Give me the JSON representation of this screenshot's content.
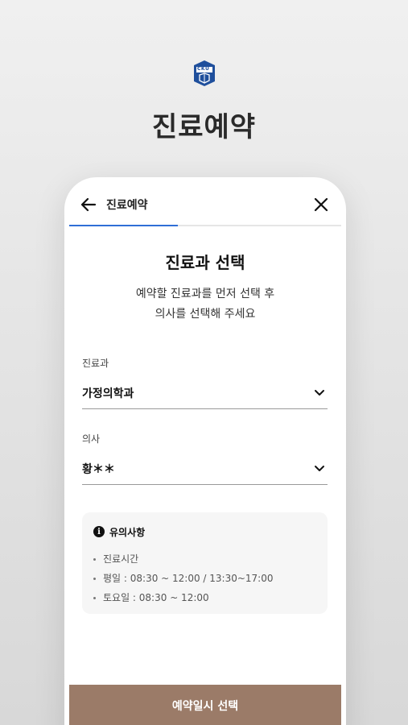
{
  "hero": {
    "logo_text": "CKU",
    "title": "진료예약"
  },
  "topbar": {
    "title": "진료예약",
    "progress_percent": 40
  },
  "step": {
    "title": "진료과 선택",
    "desc_line1": "예약할 진료과를 먼저 선택 후",
    "desc_line2": "의사를 선택해 주세요"
  },
  "fields": {
    "department": {
      "label": "진료과",
      "value": "가정의학과"
    },
    "doctor": {
      "label": "의사",
      "value": "황＊＊"
    }
  },
  "notice": {
    "title": "유의사항",
    "items": [
      "진료시간",
      "평일 : 08:30 ~ 12:00 / 13:30~17:00",
      "토요일 : 08:30 ~ 12:00"
    ]
  },
  "cta": {
    "label": "예약일시 선택"
  },
  "colors": {
    "accent": "#2f6fd6",
    "button": "#9b7b68",
    "logo": "#1f4f9c"
  }
}
